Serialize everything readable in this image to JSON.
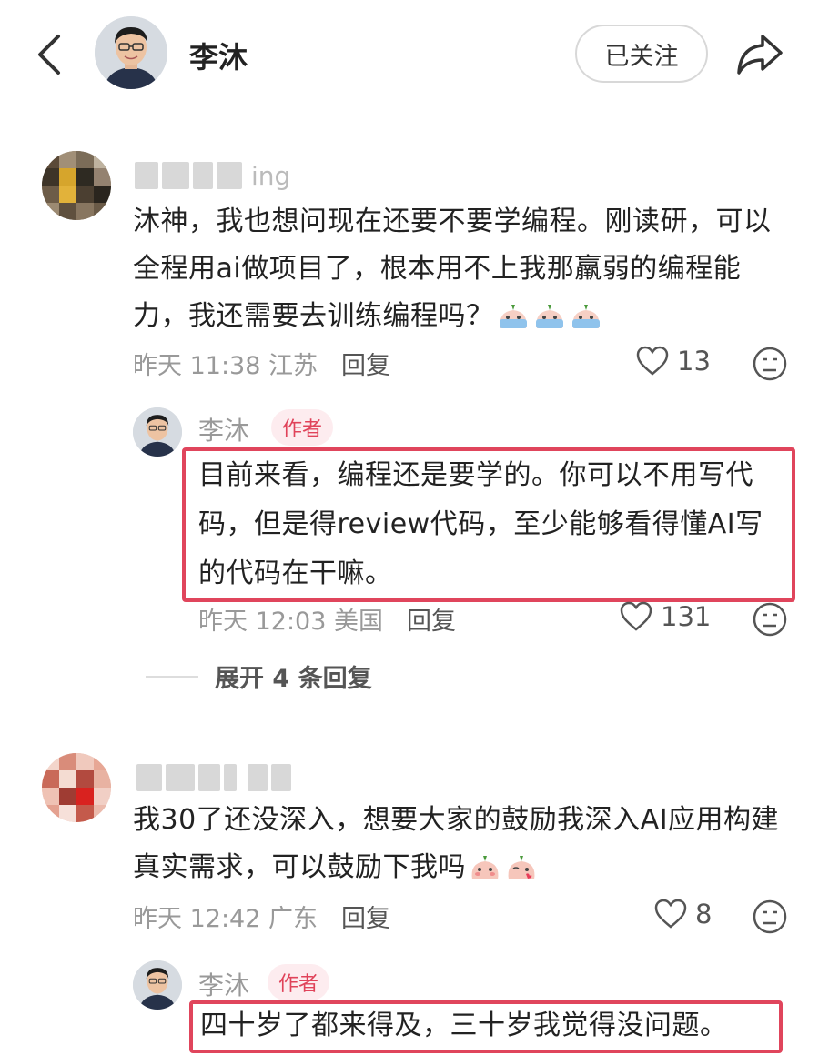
{
  "header": {
    "name": "李沐",
    "follow_label": "已关注"
  },
  "comments": [
    {
      "username_visible": "ing",
      "text": "沐神，我也想问现在还要不要学编程。刚读研，可以全程用ai做项目了，根本用不上我那羸弱的编程能力，我还需要去训练编程吗？",
      "time": "昨天 11:38",
      "location": "江苏",
      "reply_label": "回复",
      "likes": "13",
      "reply": {
        "name": "李沐",
        "tag": "作者",
        "text": "目前来看，编程还是要学的。你可以不用写代码，但是得review代码，至少能够看得懂AI写的代码在干嘛。",
        "time": "昨天 12:03",
        "location": "美国",
        "reply_label": "回复",
        "likes": "131"
      },
      "expand_label": "展开 4 条回复"
    },
    {
      "text": "我30了还没深入，想要大家的鼓励我深入AI应用构建真实需求，可以鼓励下我吗",
      "time": "昨天 12:42",
      "location": "广东",
      "reply_label": "回复",
      "likes": "8",
      "reply": {
        "name": "李沐",
        "tag": "作者",
        "text": "四十岁了都来得及，三十岁我觉得没问题。"
      }
    }
  ],
  "colors": {
    "accent": "#e0455c",
    "tag_bg": "#fdecef",
    "meta": "#999999"
  }
}
